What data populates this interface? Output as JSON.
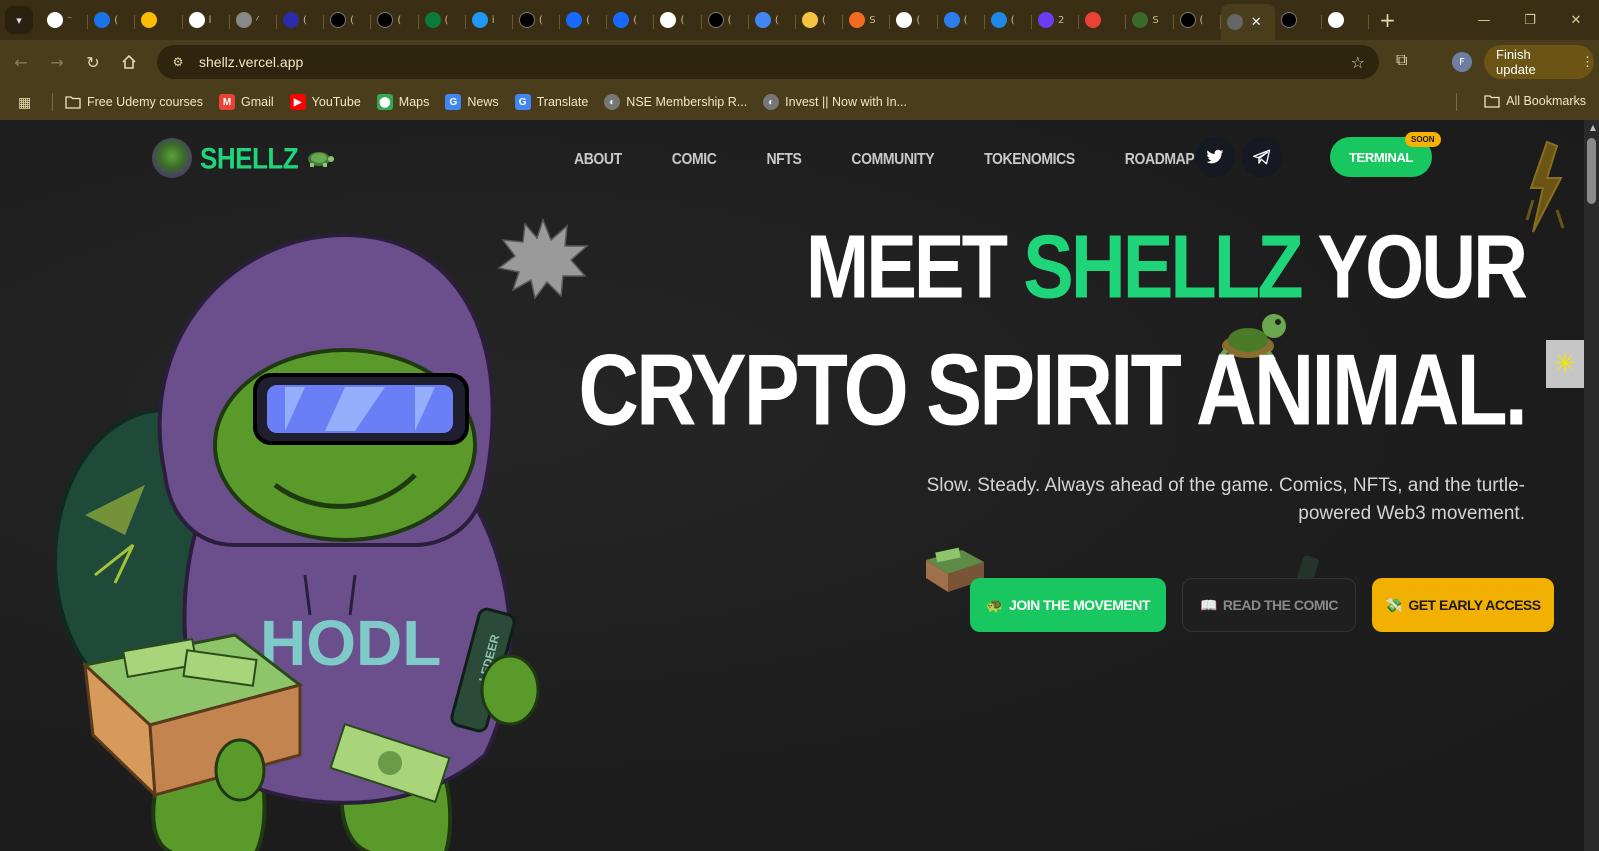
{
  "browser": {
    "tabs": [
      {
        "icon": "openai-icon",
        "color": "#ffffff"
      },
      {
        "icon": "circle-icon",
        "color": "#1a73e8"
      },
      {
        "icon": "google-drive-icon",
        "color": "#fbbc04"
      },
      {
        "icon": "google-icon",
        "color": "#ffffff"
      },
      {
        "icon": "text-icon",
        "color": "#888888"
      },
      {
        "icon": "notion-n-icon",
        "color": "#2c2ca8"
      },
      {
        "icon": "triangle-icon",
        "color": "#000000"
      },
      {
        "icon": "triangle-icon",
        "color": "#000000"
      },
      {
        "icon": "leaf-icon",
        "color": "#0c7a3a"
      },
      {
        "icon": "pin-icon",
        "color": "#2196f3"
      },
      {
        "icon": "triangle-icon",
        "color": "#000000"
      },
      {
        "icon": "behance-icon",
        "color": "#1769ff"
      },
      {
        "icon": "behance-icon",
        "color": "#1769ff"
      },
      {
        "icon": "google-icon",
        "color": "#ffffff"
      },
      {
        "icon": "notion-icon",
        "color": "#000000"
      },
      {
        "icon": "docs-icon",
        "color": "#4285f4"
      },
      {
        "icon": "layers-icon",
        "color": "#f5c242"
      },
      {
        "icon": "s-icon",
        "color": "#f26b21"
      },
      {
        "icon": "openai-icon",
        "color": "#ffffff"
      },
      {
        "icon": "window-icon",
        "color": "#2b7de9"
      },
      {
        "icon": "f-icon",
        "color": "#1e88e5"
      },
      {
        "icon": "z-icon",
        "color": "#6c3cf2"
      },
      {
        "icon": "gmail-icon",
        "color": "#ea4335"
      },
      {
        "icon": "turtle-icon",
        "color": "#3a6b2a"
      },
      {
        "icon": "triangle-icon",
        "color": "#000000"
      }
    ],
    "active_tab": {
      "icon": "dot-icon",
      "close": "✕"
    },
    "after_active": [
      {
        "icon": "triangle-icon",
        "color": "#000000"
      },
      {
        "icon": "google-icon",
        "color": "#ffffff"
      }
    ],
    "tab_fragments": [
      "⁻",
      "(",
      "",
      "l",
      "⁄",
      "(",
      "(",
      "(",
      "(",
      "i",
      "(",
      "(",
      "(",
      "(",
      "(",
      "(",
      "(",
      "S",
      "(",
      "(",
      "(",
      "2",
      "",
      "S",
      "("
    ],
    "new_tab": "+",
    "window": {
      "minimize": "—",
      "maximize": "❐",
      "close": "✕"
    },
    "url": "shellz.vercel.app",
    "finish_update": "Finish update",
    "profile_initial": "F",
    "bookmarks": [
      {
        "label": "Free Udemy courses",
        "icon": "folder-icon"
      },
      {
        "label": "Gmail",
        "icon": "gmail-icon"
      },
      {
        "label": "YouTube",
        "icon": "youtube-icon"
      },
      {
        "label": "Maps",
        "icon": "maps-icon"
      },
      {
        "label": "News",
        "icon": "news-icon"
      },
      {
        "label": "Translate",
        "icon": "translate-icon"
      },
      {
        "label": "NSE Membership R...",
        "icon": "globe-icon"
      },
      {
        "label": "Invest || Now with In...",
        "icon": "globe-icon"
      }
    ],
    "all_bookmarks": "All Bookmarks"
  },
  "site": {
    "logo_text": "SHELLZ",
    "nav": [
      "ABOUT",
      "COMIC",
      "NFTS",
      "COMMUNITY",
      "TOKENOMICS",
      "ROADMAP"
    ],
    "terminal_label": "TERMINAL",
    "soon_badge": "SOON",
    "hero": {
      "line1_a": "MEET ",
      "line1_accent": "SHELLZ",
      "line1_b": " YOUR",
      "line2": "CRYPTO SPIRIT ANIMAL."
    },
    "subtitle": "Slow. Steady. Always ahead of the game. Comics, NFTs, and the turtle-powered Web3 movement.",
    "cta": {
      "join": {
        "emoji": "🐢",
        "label": "JOIN THE MOVEMENT"
      },
      "read": {
        "emoji": "📖",
        "label": "READ THE COMIC"
      },
      "early": {
        "emoji": "💸",
        "label": "GET EARLY ACCESS"
      }
    },
    "mascot_text": "HODL",
    "ledger_text": "LEDEER",
    "colors": {
      "accent_green": "#1fd57a",
      "button_green": "#18c75f",
      "gold": "#f2b100",
      "hoodie": "#6a4f8c"
    }
  }
}
